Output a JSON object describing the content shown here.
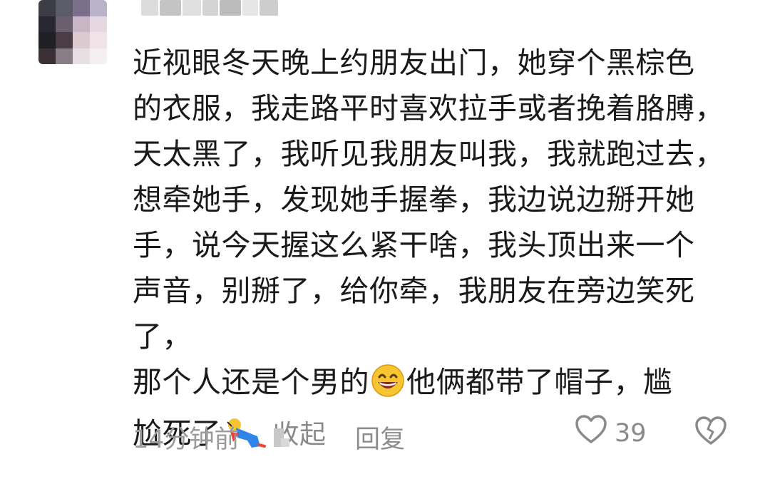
{
  "comment": {
    "lines": [
      "近视眼冬天晚上约朋友出门，她穿个黑棕色",
      "的衣服，我走路平时喜欢拉手或者挽着胳膊，",
      "天太黑了，我听见我朋友叫我，我就跑过去，",
      "想牵她手，发现她手握拳，我边说边掰开她",
      "手，说今天握这么紧干啥，我头顶出来一个",
      "声音，别掰了，给你牵，我朋友在旁边笑死了，",
      "那个人还是个男的"
    ],
    "after_grin": "他俩都带了帽子，尴",
    "last_line": "尬死了",
    "collapse_label": "收起",
    "emojis": [
      "grinning-face-emoji",
      "fallen-person-emoji"
    ]
  },
  "footer": {
    "timestamp": "14分钟前",
    "reply_label": "回复",
    "like_count": "39"
  },
  "colors": {
    "text": "#1a1a1a",
    "muted": "#9b9b9b",
    "emoji_yellow": "#f7c531"
  }
}
